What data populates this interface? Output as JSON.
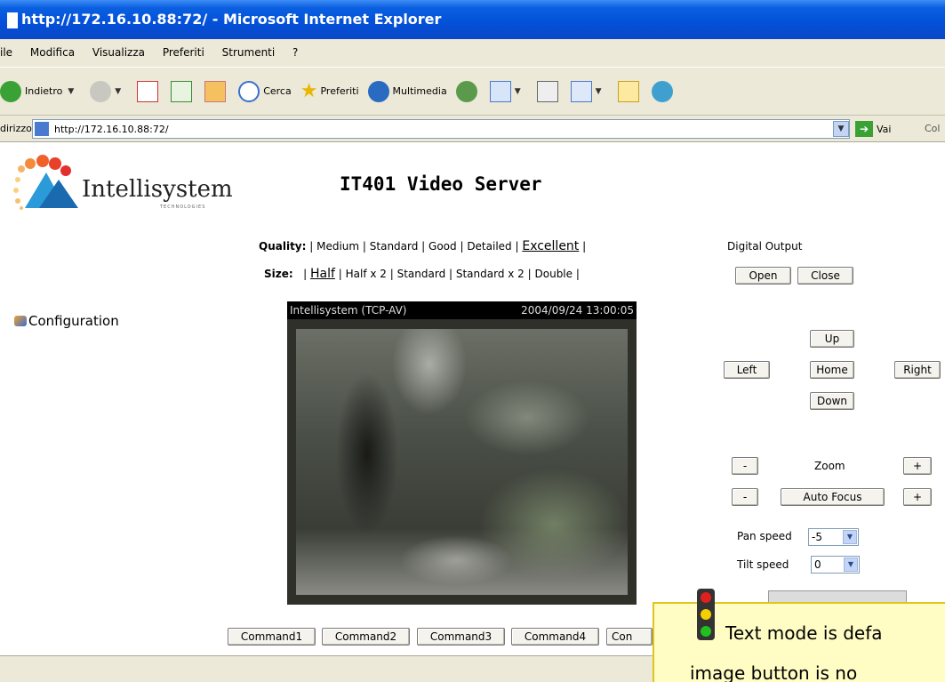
{
  "window": {
    "title": "http://172.16.10.88:72/ - Microsoft Internet Explorer"
  },
  "menubar": {
    "items": [
      "ile",
      "Modifica",
      "Visualizza",
      "Preferiti",
      "Strumenti",
      "?"
    ]
  },
  "toolbar": {
    "back_label": "Indietro",
    "search_label": "Cerca",
    "favorites_label": "Preferiti",
    "multimedia_label": "Multimedia"
  },
  "addressbar": {
    "label": "dirizzo",
    "url": "http://172.16.10.88:72/",
    "go_label": "Vai",
    "links_label": "Col"
  },
  "logo": {
    "text": "Intellisystem",
    "sub": "TECHNOLOGIES"
  },
  "page": {
    "title": "IT401 Video Server",
    "config_link": "Configuration"
  },
  "quality": {
    "label": "Quality:",
    "options": [
      "Medium",
      "Standard",
      "Good",
      "Detailed",
      "Excellent"
    ],
    "selected": "Excellent"
  },
  "size": {
    "label": "Size:",
    "options": [
      "Half",
      "Half x 2",
      "Standard",
      "Standard x 2",
      "Double"
    ],
    "selected": "Half"
  },
  "digital_output": {
    "label": "Digital Output",
    "open": "Open",
    "close": "Close"
  },
  "video": {
    "source": "Intellisystem (TCP-AV)",
    "timestamp": "2004/09/24 13:00:05"
  },
  "ptz": {
    "up": "Up",
    "left": "Left",
    "home": "Home",
    "right": "Right",
    "down": "Down",
    "minus": "-",
    "plus": "+",
    "zoom_label": "Zoom",
    "focus_label": "Auto Focus",
    "pan_speed_label": "Pan speed",
    "pan_speed_value": "-5",
    "tilt_speed_label": "Tilt speed",
    "tilt_speed_value": "0"
  },
  "commands": [
    "Command1",
    "Command2",
    "Command3",
    "Command4",
    "Con"
  ],
  "tooltip": {
    "line1": "Text mode is defa",
    "line2": "image button is no"
  }
}
